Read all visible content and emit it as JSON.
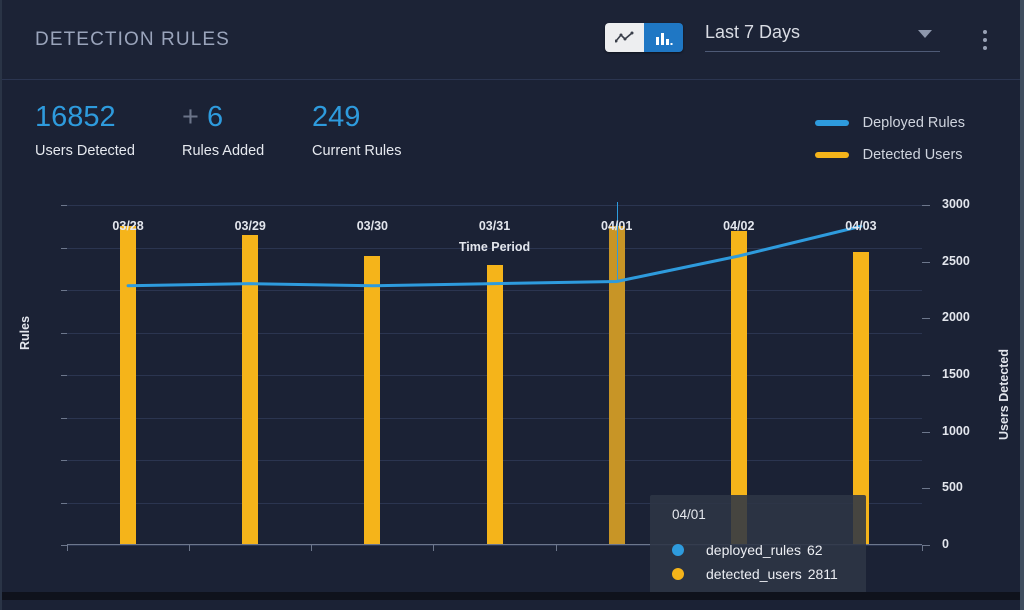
{
  "header": {
    "title": "DETECTION RULES",
    "chart_type_toggle": [
      {
        "name": "line-chart-icon",
        "state": "selected"
      },
      {
        "name": "bar-chart-icon",
        "state": "active"
      }
    ],
    "range_select": {
      "value": "Last 7 Days",
      "caret": "chevron-down-icon"
    },
    "overflow_menu": "more-vertical-icon"
  },
  "kpis": [
    {
      "value": "16852",
      "prefix": "",
      "label": "Users Detected"
    },
    {
      "value": "6",
      "prefix": "+",
      "label": "Rules Added"
    },
    {
      "value": "249",
      "prefix": "",
      "label": "Current Rules"
    }
  ],
  "legend": [
    {
      "label": "Deployed Rules",
      "color": "#2e9bdd"
    },
    {
      "label": "Detected Users",
      "color": "#f5b41a"
    }
  ],
  "tooltip": {
    "title": "04/01",
    "rows": [
      {
        "dot_color": "#2e9bdd",
        "name": "deployed_rules",
        "value": "62"
      },
      {
        "dot_color": "#f5b41a",
        "name": "detected_users",
        "value": "2811"
      }
    ]
  },
  "colors": {
    "panel_bg": "#1b2235",
    "header_bg": "#1c2336",
    "accent_blue": "#2e9bdd",
    "accent_amber": "#f5b41a",
    "amber_hover": "#c89526",
    "grid": "#2b3550",
    "text": "#e3e6ed"
  },
  "chart_data": {
    "type": "bar",
    "title": "",
    "xlabel": "Time Period",
    "ylabel": "Rules",
    "y2label": "Users Detected",
    "categories": [
      "03/28",
      "03/29",
      "03/30",
      "03/31",
      "04/01",
      "04/02",
      "04/03"
    ],
    "ylim": [
      0,
      80
    ],
    "yticks": [
      0,
      10,
      20,
      30,
      40,
      50,
      60,
      70,
      80
    ],
    "y2lim": [
      0,
      3000
    ],
    "y2ticks": [
      0,
      500,
      1000,
      1500,
      2000,
      2500,
      3000
    ],
    "grid": true,
    "legend_position": "top-right",
    "hovered_category": "04/01",
    "series": [
      {
        "name": "Detected Users",
        "type": "bar",
        "axis": "right",
        "color": "#f5b41a",
        "values": [
          2813,
          2738,
          2550,
          2475,
          2811,
          2775,
          2588
        ],
        "values_left_scale": [
          75,
          73,
          68,
          66,
          70,
          74,
          69
        ]
      },
      {
        "name": "Deployed Rules",
        "type": "line",
        "axis": "left",
        "color": "#2e9bdd",
        "values": [
          61,
          61.5,
          61,
          61.5,
          62,
          68,
          75
        ]
      }
    ]
  }
}
